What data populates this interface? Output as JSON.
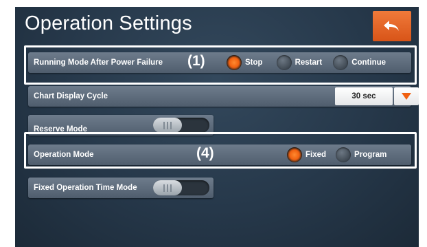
{
  "header": {
    "title": "Operation Settings",
    "back_icon": "back-arrow-icon",
    "back_color": "#e8662a"
  },
  "settings": {
    "power_failure": {
      "label": "Running Mode After Power Failure",
      "callout": "(1)",
      "options": [
        "Stop",
        "Restart",
        "Continue"
      ],
      "selected": "Stop"
    },
    "chart_display": {
      "label": "Chart Display Cycle",
      "value": "30 sec",
      "dropdown_icon": "triangle-down-icon"
    },
    "reserve_mode": {
      "label": "Reserve Mode",
      "state": "off"
    },
    "operation_mode": {
      "label": "Operation Mode",
      "callout": "(4)",
      "options": [
        "Fixed",
        "Program"
      ],
      "selected": "Fixed"
    },
    "fixed_time_mode": {
      "label": "Fixed Operation Time Mode",
      "state": "off"
    }
  },
  "colors": {
    "accent": "#f06010",
    "panel": "#5d6b7b",
    "background": "#26384a"
  }
}
